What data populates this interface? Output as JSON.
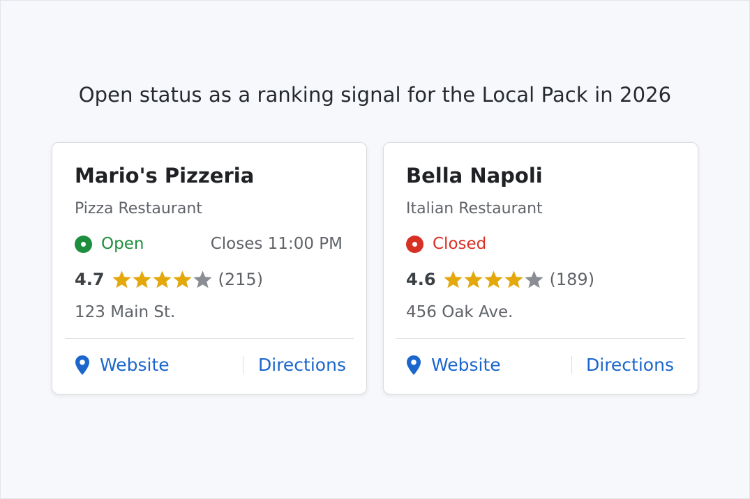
{
  "headline": "Open status as a ranking signal for the Local Pack in 2026",
  "colors": {
    "open": "#1e8e3e",
    "closed": "#d93025",
    "star_filled": "#e2a80c",
    "star_empty": "#8a8d93",
    "link": "#1a66cc"
  },
  "listings": [
    {
      "name": "Mario's Pizzeria",
      "category": "Pizza Restaurant",
      "status": "Open",
      "status_color": "#1e8e3e",
      "closes": "Closes 11:00 PM",
      "rating": "4.7",
      "stars_filled": 4,
      "stars_total": 5,
      "reviews": "(215)",
      "address": "123 Main St.",
      "website_label": "Website",
      "directions_label": "Directions",
      "website_icon": "location-pin-icon"
    },
    {
      "name": "Bella Napoli",
      "category": "Italian Restaurant",
      "status": "Closed",
      "status_color": "#d93025",
      "closes": "",
      "rating": "4.6",
      "stars_filled": 4,
      "stars_total": 5,
      "reviews": "(189)",
      "address": "456 Oak Ave.",
      "website_label": "Website",
      "directions_label": "Directions",
      "website_icon": "location-pin-icon"
    }
  ]
}
